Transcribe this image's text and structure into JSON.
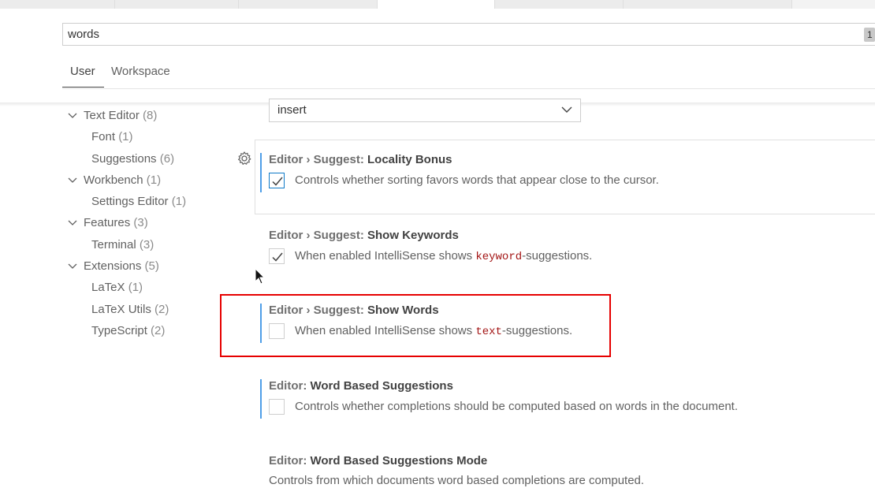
{
  "search": {
    "value": "words",
    "count": "1"
  },
  "scopes": {
    "user": "User",
    "workspace": "Workspace"
  },
  "toc": [
    {
      "label": "Text Editor",
      "count": "(8)"
    },
    {
      "label": "Font",
      "count": "(1)"
    },
    {
      "label": "Suggestions",
      "count": "(6)"
    },
    {
      "label": "Workbench",
      "count": "(1)"
    },
    {
      "label": "Settings Editor",
      "count": "(1)"
    },
    {
      "label": "Features",
      "count": "(3)"
    },
    {
      "label": "Terminal",
      "count": "(3)"
    },
    {
      "label": "Extensions",
      "count": "(5)"
    },
    {
      "label": "LaTeX",
      "count": "(1)"
    },
    {
      "label": "LaTeX Utils",
      "count": "(2)"
    },
    {
      "label": "TypeScript",
      "count": "(2)"
    }
  ],
  "dropdown": {
    "value": "insert"
  },
  "settings": [
    {
      "category": "Editor › Suggest: ",
      "key": "Locality Bonus",
      "desc": "Controls whether sorting favors words that appear close to the cursor.",
      "checked": true
    },
    {
      "category": "Editor › Suggest: ",
      "key": "Show Keywords",
      "desc_before": "When enabled IntelliSense shows ",
      "desc_code": "keyword",
      "desc_after": "-suggestions.",
      "checked": true
    },
    {
      "category": "Editor › Suggest: ",
      "key": "Show Words",
      "desc_before": "When enabled IntelliSense shows ",
      "desc_code": "text",
      "desc_after": "-suggestions.",
      "checked": false
    },
    {
      "category": "Editor: ",
      "key": "Word Based Suggestions",
      "desc": "Controls whether completions should be computed based on words in the document.",
      "checked": false
    },
    {
      "category": "Editor: ",
      "key": "Word Based Suggestions Mode",
      "desc": "Controls from which documents word based completions are computed."
    }
  ],
  "colors": {
    "accent": "#0f7ac8",
    "modified_bar": "#4f9ee8",
    "highlight": "#e60000",
    "code": "#a31515"
  },
  "icons": [
    "gear-icon",
    "chevron-down-icon",
    "check-icon",
    "mouse-cursor-icon"
  ]
}
